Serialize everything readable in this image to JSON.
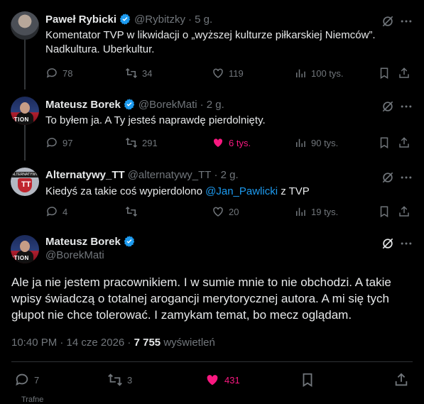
{
  "colors": {
    "accent": "#1d9bf0",
    "like": "#f91880",
    "muted": "#71767b",
    "text": "#e7e9ea"
  },
  "replies": [
    {
      "name": "Paweł Rybicki",
      "handle": "@Rybitzky",
      "time": "· 5 g.",
      "text_lines": [
        "Komentator TVP w likwidacji o „wyższej kulturze piłkarskiej Niemców”.",
        "Nadkultura. Uberkultur."
      ],
      "stats": {
        "replies": "78",
        "retweets": "34",
        "likes": "119",
        "views": "100 tys."
      },
      "liked": false
    },
    {
      "name": "Mateusz Borek",
      "handle": "@BorekMati",
      "time": "· 2 g.",
      "text": "To byłem ja. A Ty jesteś naprawdę pierdolnięty.",
      "stats": {
        "replies": "97",
        "retweets": "291",
        "likes": "6 tys.",
        "views": "90 tys."
      },
      "liked": true
    },
    {
      "name": "Alternatywy_TT",
      "handle": "@alternatywy_TT",
      "time": "· 2 g.",
      "text_before": "Kiedyś za takie coś wypierdolono ",
      "mention": "@Jan_Pawlicki",
      "text_after": " z TVP",
      "stats": {
        "replies": "4",
        "retweets": "",
        "likes": "20",
        "views": "19 tys."
      },
      "liked": false
    }
  ],
  "main": {
    "name": "Mateusz Borek",
    "handle": "@BorekMati",
    "text": "Ale ja nie jestem pracownikiem. I w sumie mnie to nie obchodzi. A takie wpisy świadczą o totalnej arogancji merytorycznej autora. A mi się tych głupot nie chce tolerować. I zamykam temat, bo mecz oglądam.",
    "time": "10:40 PM · 14 cze 2026 · ",
    "views_count": "7 755",
    "views_label": " wyświetleń",
    "stats": {
      "replies": "7",
      "retweets": "3",
      "likes": "431"
    }
  },
  "avatar_labels": {
    "borek": "OTION",
    "alt_band": "ALTERNATYWY",
    "alt_shield": "TT"
  },
  "footer_partial": "Trafne"
}
